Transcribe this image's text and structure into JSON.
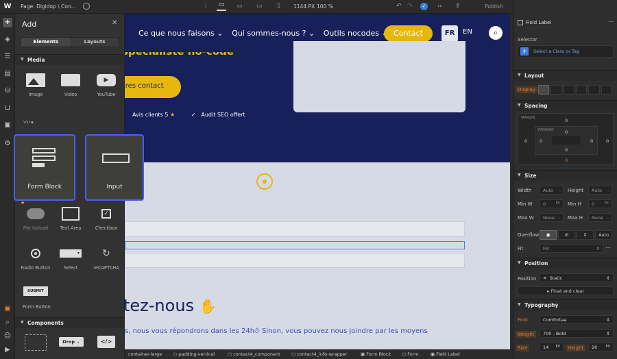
{
  "topbar": {
    "page_label": "Page: Digidop \\ Con...",
    "size_px": "1144 PX",
    "zoom": "100 %",
    "publish": "Publish"
  },
  "add_panel": {
    "title": "Add",
    "tabs": [
      "Elements",
      "Layouts"
    ],
    "sections": {
      "media": "Media",
      "components": "Components"
    },
    "media_items": [
      "Image",
      "Video",
      "YouTube"
    ],
    "form_items": [
      "Form Block",
      "Input"
    ],
    "form_items_row2": [
      "File Upload",
      "Text Area",
      "Checkbox"
    ],
    "form_items_row3": [
      "Radio Button",
      "Select",
      "reCAPTCHA"
    ],
    "submit_label": "SUBMIT",
    "form_button_label": "Form Button",
    "component_drop_label": "Drop"
  },
  "canvas": {
    "nav": [
      "Ce que nous faisons",
      "Qui sommes-nous ?",
      "Outils nocodes"
    ],
    "contact_btn": "Contact",
    "lang_fr": "FR",
    "lang_en": "EN",
    "hero_headline_fragment": "spécialiste no-code",
    "hero_cta": "ires contact",
    "avis": "Avis clients 5",
    "audit": "Audit SEO offert",
    "section_heading": "tez-nous",
    "section_text": "s, nous vous répondrons dans les 24h⏱ Sinon, vous pouvez nous joindre par les moyens"
  },
  "right_panel": {
    "element_name": "Field Label",
    "selector_label": "Selector",
    "selector_placeholder": "Select a Class or Tag",
    "layout": "Layout",
    "display": "Display",
    "spacing": "Spacing",
    "margin": "MARGIN",
    "padding": "PADDING",
    "spacing_values": {
      "m_top": "0",
      "m_left": "0",
      "m_right": "0",
      "m_bottom": "0",
      "p_top": "0",
      "p_left": "0",
      "p_right": "0",
      "p_bottom": "0"
    },
    "size": "Size",
    "width_label": "Width",
    "height_label": "Height",
    "min_w": "Min W",
    "min_h": "Min H",
    "max_w": "Max W",
    "max_h": "Max H",
    "auto": "Auto",
    "none": "None",
    "zero": "0",
    "px": "PX",
    "overflow": "Overflow",
    "overflow_auto": "Auto",
    "fit": "Fit",
    "fit_value": "Fill",
    "position": "Position",
    "position_label": "Position",
    "position_value": "Static",
    "float_clear": "Float and clear",
    "typography": "Typography",
    "font_label": "Font",
    "font_value": "Comfortaa",
    "weight_label": "Weight",
    "weight_value": "700 - Bold",
    "size_label": "Size",
    "size_value": "14",
    "height_label2": "Height",
    "height_value": "20"
  },
  "breadcrumb": [
    "container-large",
    "padding-vertical",
    "contact4_component",
    "contact4_info-wrapper",
    "Form Block",
    "Form",
    "Field Label"
  ],
  "colors": {
    "accent": "#4b5eff",
    "navy": "#17205a",
    "yellow": "#e7b711"
  }
}
